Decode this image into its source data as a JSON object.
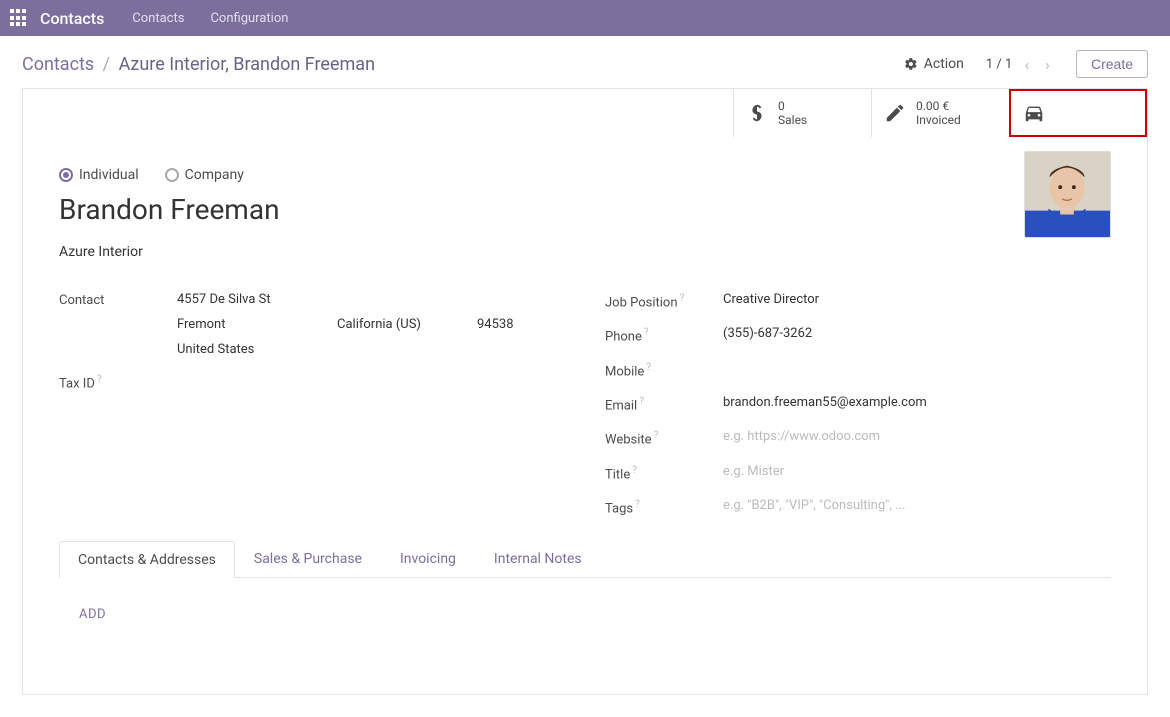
{
  "topbar": {
    "brand": "Contacts",
    "nav": {
      "contacts": "Contacts",
      "configuration": "Configuration"
    }
  },
  "breadcrumb": {
    "root": "Contacts",
    "current": "Azure Interior, Brandon Freeman"
  },
  "actions": {
    "action_label": "Action",
    "create_label": "Create"
  },
  "pager": {
    "text": "1 / 1"
  },
  "stats": {
    "sales": {
      "value": "0",
      "label": "Sales"
    },
    "invoiced": {
      "value": "0.00 €",
      "label": "Invoiced"
    }
  },
  "radios": {
    "individual": "Individual",
    "company": "Company"
  },
  "name": "Brandon Freeman",
  "company": "Azure Interior",
  "address": {
    "label": "Contact",
    "street": "4557 De Silva St",
    "city": "Fremont",
    "state": "California (US)",
    "zip": "94538",
    "country": "United States"
  },
  "tax_id": {
    "label": "Tax ID"
  },
  "right_fields": {
    "job_position": {
      "label": "Job Position",
      "value": "Creative Director"
    },
    "phone": {
      "label": "Phone",
      "value": "(355)-687-3262"
    },
    "mobile": {
      "label": "Mobile",
      "value": ""
    },
    "email": {
      "label": "Email",
      "value": "brandon.freeman55@example.com"
    },
    "website": {
      "label": "Website",
      "placeholder": "e.g. https://www.odoo.com"
    },
    "title": {
      "label": "Title",
      "placeholder": "e.g. Mister"
    },
    "tags": {
      "label": "Tags",
      "placeholder": "e.g. \"B2B\", \"VIP\", \"Consulting\", ..."
    }
  },
  "tabs": {
    "contacts": "Contacts & Addresses",
    "sales": "Sales & Purchase",
    "invoicing": "Invoicing",
    "notes": "Internal Notes"
  },
  "add_button": "ADD"
}
